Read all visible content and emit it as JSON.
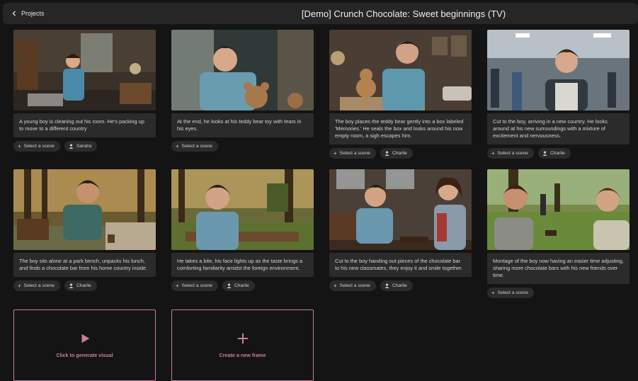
{
  "header": {
    "back_label": "Projects",
    "title": "[Demo] Crunch Chocolate: Sweet beginnings (TV)"
  },
  "frames": [
    {
      "caption": "A young boy is cleaning out his room. He's packing up to move to a different country",
      "scene_label": "Select a scene",
      "character": "Sandra"
    },
    {
      "caption": "At the end, he looks at his teddy bear toy with tears in his eyes.",
      "scene_label": "Select a scene",
      "character": null
    },
    {
      "caption": "The boy places the teddy bear gently into a box labeled 'Memories.' He seals the box and looks around his now empty room, a sigh escapes him.",
      "scene_label": "Select a scene",
      "character": "Charlie"
    },
    {
      "caption": "Cut to the boy, arriving in a new country. He looks around at his new surroundings with a mixture of excitement and nervousness.",
      "scene_label": "Select a scene",
      "character": "Charlie"
    },
    {
      "caption": "The boy sits alone at a park bench, unpacks his lunch, and finds a chocolate bar from his home country inside.",
      "scene_label": "Select a scene",
      "character": "Charlie"
    },
    {
      "caption": "He takes a bite, his face lights up as the taste brings a comforting familiarity amidst the foreign environment.",
      "scene_label": "Select a scene",
      "character": "Charlie"
    },
    {
      "caption": "Cut to the boy handing out pieces of the chocolate bar to his new classmates, they enjoy it and smile together.",
      "scene_label": "Select a scene",
      "character": "Charlie"
    },
    {
      "caption": "Montage of the boy now having an easier time adjusting, sharing more chocolate bars with his new friends over time.",
      "scene_label": "Select a scene",
      "character": null
    }
  ],
  "actions": {
    "generate_visual": "Click to generate visual",
    "new_frame": "Create a new frame"
  },
  "colors": {
    "accent": "#c97ea1",
    "background": "#141414",
    "card": "#2b2b2b",
    "topbar": "#262626"
  }
}
